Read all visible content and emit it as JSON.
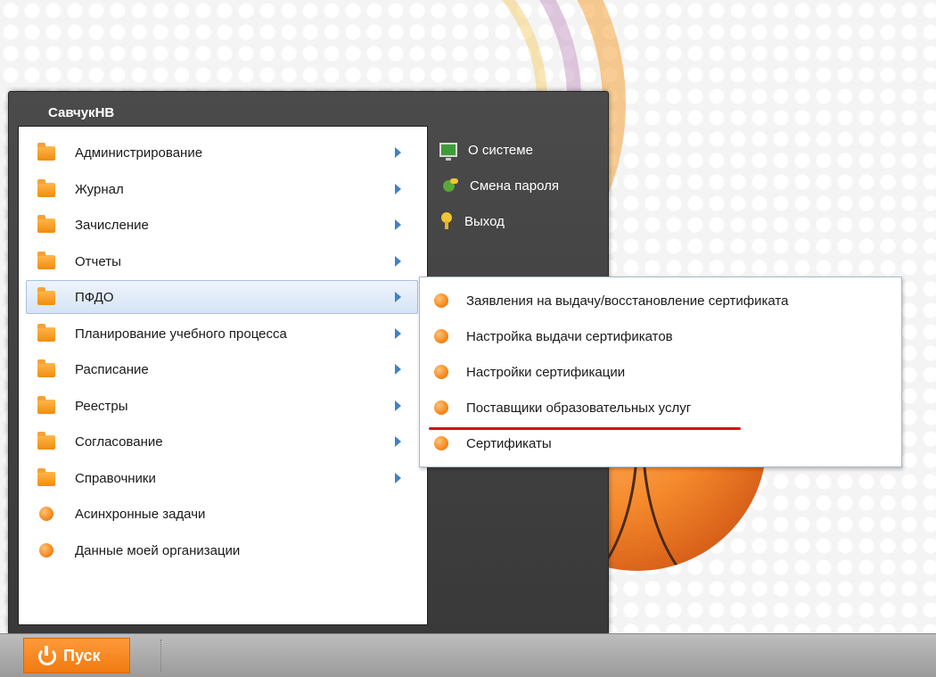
{
  "start_menu": {
    "user_name": "СавчукНВ",
    "items": [
      {
        "label": "Администрирование"
      },
      {
        "label": "Журнал"
      },
      {
        "label": "Зачисление"
      },
      {
        "label": "Отчеты"
      },
      {
        "label": "ПФДО"
      },
      {
        "label": "Планирование учебного процесса"
      },
      {
        "label": "Расписание"
      },
      {
        "label": "Реестры"
      },
      {
        "label": "Согласование"
      },
      {
        "label": "Справочники"
      },
      {
        "label": "Асинхронные задачи"
      },
      {
        "label": "Данные моей организации"
      }
    ],
    "right_items": [
      {
        "label": "О системе",
        "icon": "monitor-icon"
      },
      {
        "label": "Смена пароля",
        "icon": "change-password-icon"
      },
      {
        "label": "Выход",
        "icon": "exit-key-icon"
      }
    ]
  },
  "submenu": {
    "items": [
      {
        "label": "Заявления на выдачу/восстановление сертификата"
      },
      {
        "label": "Настройка выдачи сертификатов"
      },
      {
        "label": "Настройки сертификации"
      },
      {
        "label": "Поставщики образовательных услуг"
      },
      {
        "label": "Сертификаты"
      }
    ]
  },
  "taskbar": {
    "start_label": "Пуск"
  },
  "colors": {
    "accent_orange": "#f58a1f",
    "arrow_blue": "#3f82c8",
    "menu_dark": "#434343",
    "highlight_red": "#d11313"
  }
}
